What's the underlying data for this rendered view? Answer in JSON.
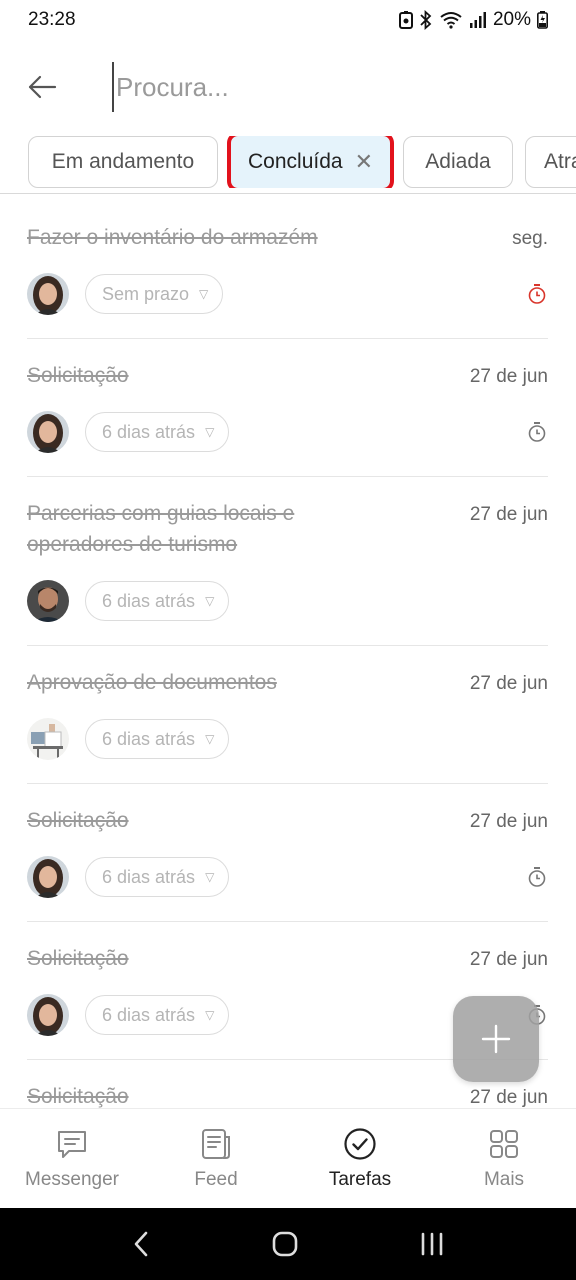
{
  "status_bar": {
    "time": "23:28",
    "battery": "20%"
  },
  "search": {
    "placeholder": "Procura..."
  },
  "filters": [
    {
      "label": "Em andamento",
      "active": false
    },
    {
      "label": "Concluída",
      "active": true
    },
    {
      "label": "Adiada",
      "active": false
    },
    {
      "label": "Atra",
      "active": false
    }
  ],
  "tasks": [
    {
      "title": "Fazer o inventário do armazém",
      "date": "seg.",
      "deadline": "Sem prazo",
      "avatar": "woman",
      "timer": "red"
    },
    {
      "title": "Solicitação",
      "date": "27 de jun",
      "deadline": "6 dias atrás",
      "avatar": "woman",
      "timer": "gray"
    },
    {
      "title": "Parcerias com guias locais e operadores de turismo",
      "date": "27 de jun",
      "deadline": "6 dias atrás",
      "avatar": "man",
      "timer": ""
    },
    {
      "title": "Aprovação de documentos",
      "date": "27 de jun",
      "deadline": "6 dias atrás",
      "avatar": "office",
      "timer": ""
    },
    {
      "title": "Solicitação",
      "date": "27 de jun",
      "deadline": "6 dias atrás",
      "avatar": "woman",
      "timer": "gray"
    },
    {
      "title": "Solicitação",
      "date": "27 de jun",
      "deadline": "6 dias atrás",
      "avatar": "woman",
      "timer": "gray"
    },
    {
      "title": "Solicitação",
      "date": "27 de jun",
      "deadline": "",
      "avatar": "",
      "timer": ""
    }
  ],
  "nav": {
    "messenger": "Messenger",
    "feed": "Feed",
    "tasks": "Tarefas",
    "more": "Mais"
  },
  "colors": {
    "accent_red": "#e2121c",
    "chip_active_bg": "#e5f3fb",
    "timer_red": "#d9352b",
    "fab": "#a0a0a0"
  }
}
